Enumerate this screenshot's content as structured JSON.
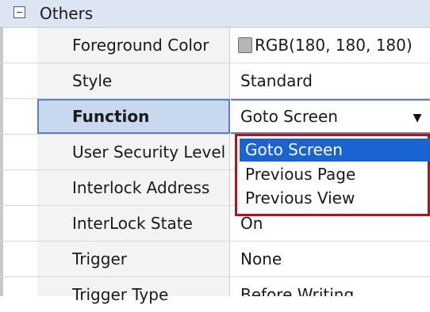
{
  "category": {
    "label": "Others",
    "expanded": true
  },
  "rows": [
    {
      "name": "Foreground Color",
      "value": "RGB(180, 180, 180)",
      "swatch_color": "#b4b4b4"
    },
    {
      "name": "Style",
      "value": "Standard"
    },
    {
      "name": "Function",
      "value": "Goto Screen"
    },
    {
      "name": "User Security Level",
      "value": ""
    },
    {
      "name": "Interlock Address",
      "value": ""
    },
    {
      "name": "InterLock State",
      "value": "On"
    },
    {
      "name": "Trigger",
      "value": "None"
    },
    {
      "name": "Trigger Type",
      "value": "Before Writing"
    }
  ],
  "dropdown": {
    "options": [
      "Goto Screen",
      "Previous Page",
      "Previous View"
    ],
    "selected": "Goto Screen",
    "highlight_color": "#c00f14"
  },
  "colors": {
    "category_bg": "#dde5f2",
    "selection_bg": "#1a64d2",
    "selected_row_bg": "#c8d8ef"
  }
}
